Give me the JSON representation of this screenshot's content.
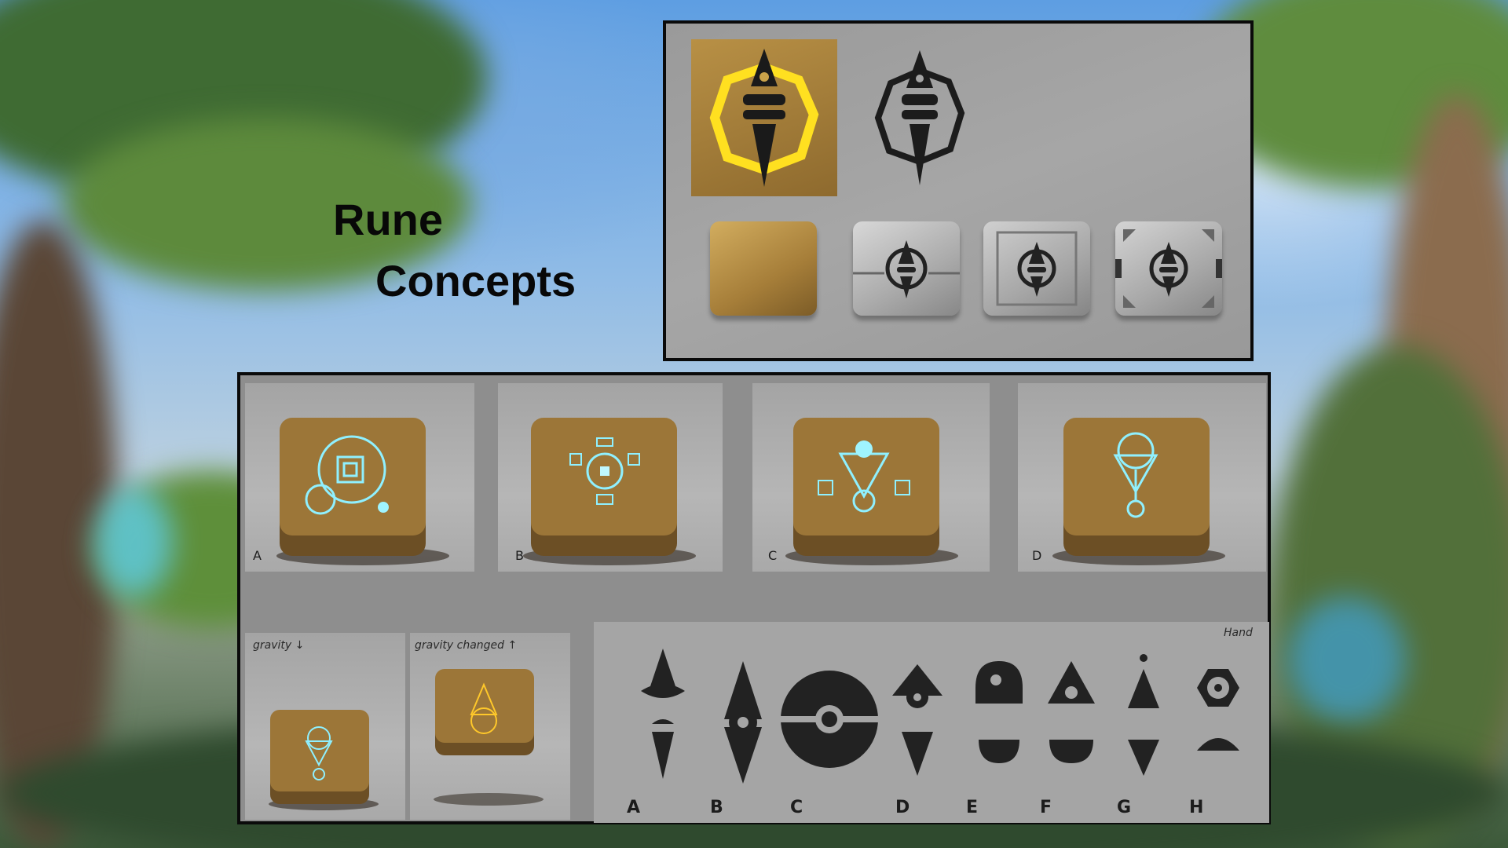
{
  "title": {
    "line1": "Rune",
    "line2": "Concepts"
  },
  "colors": {
    "glow_gold": "#ffd21a",
    "glow_cyan": "#7fe6ff",
    "stone": "#8a6a35",
    "panel_border": "#0a0a0a"
  },
  "top_panel": {
    "icons": [
      "glowing-rune-tile",
      "rune-symbol-outline"
    ],
    "blocks": [
      "plain-stone-block",
      "rune-stone-block-1",
      "rune-stone-block-2",
      "rune-stone-block-3"
    ]
  },
  "cube_concepts": [
    {
      "label": "A",
      "rune": "spiral-circles"
    },
    {
      "label": "B",
      "rune": "square-glyph"
    },
    {
      "label": "C",
      "rune": "triangle-spirals"
    },
    {
      "label": "D",
      "rune": "triangle-circle"
    }
  ],
  "gravity": [
    {
      "note": "gravity ↓",
      "glow": "cyan"
    },
    {
      "note": "gravity changed ↑",
      "glow": "gold"
    }
  ],
  "symbols": {
    "note": "Hand",
    "letters": [
      "A",
      "B",
      "C",
      "D",
      "E",
      "F",
      "G",
      "H"
    ]
  }
}
